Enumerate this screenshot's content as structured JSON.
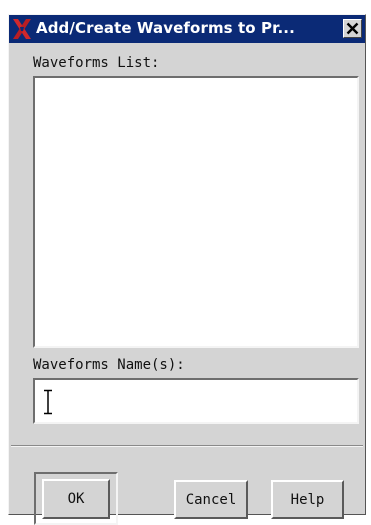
{
  "window": {
    "title": "Add/Create Waveforms to Pr...",
    "close_icon": "close-icon",
    "logo_icon": "x-logo-icon"
  },
  "waveforms_list": {
    "label": "Waveforms List:",
    "items": []
  },
  "waveform_name": {
    "label": "Waveforms Name(s):",
    "value": ""
  },
  "buttons": {
    "ok": "OK",
    "cancel": "Cancel",
    "help": "Help"
  },
  "colors": {
    "titlebar": "#0b2a76",
    "logo": "#d0282c",
    "window_bg": "#d4d4d4"
  }
}
